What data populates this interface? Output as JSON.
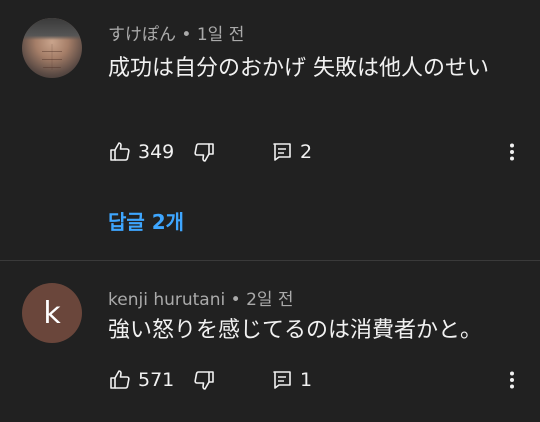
{
  "comments": [
    {
      "author": "すけぽん",
      "time": "1일 전",
      "text": "成功は自分のおかげ  失敗は他人のせい",
      "likes": "349",
      "reply_count": "2",
      "view_replies": "답글 2개"
    },
    {
      "avatar_letter": "k",
      "author": "kenji hurutani",
      "time": "2일 전",
      "text": "強い怒りを感じてるのは消費者かと。",
      "likes": "571",
      "reply_count": "1"
    }
  ],
  "separator": " • ",
  "colors": {
    "background": "#212121",
    "link": "#3ea6ff",
    "avatar_k": "#6a463b",
    "meta_text": "#aaaaaa"
  },
  "icons": [
    "thumbs-up-icon",
    "thumbs-down-icon",
    "reply-icon",
    "more-vert-icon"
  ]
}
